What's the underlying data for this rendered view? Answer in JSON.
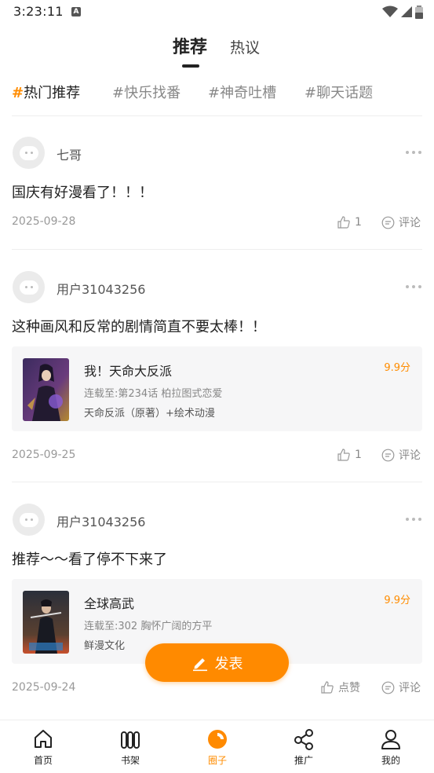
{
  "status_bar": {
    "time": "3:23:11",
    "notif_letter": "A"
  },
  "top_tabs": {
    "active": "推荐",
    "second": "热议"
  },
  "topics": [
    {
      "hash": "#",
      "label": "热门推荐"
    },
    {
      "label": "#快乐找番"
    },
    {
      "label": "#神奇吐槽"
    },
    {
      "label": "#聊天话题"
    }
  ],
  "posts": [
    {
      "user": "七哥",
      "text": "国庆有好漫看了！！！",
      "date": "2025-09-28",
      "likes": "1",
      "comment_label": "评论"
    },
    {
      "user": "用户31043256",
      "text": "这种画风和反常的剧情简直不要太棒！！",
      "card": {
        "title": "我！天命大反派",
        "score": "9.9分",
        "update": "连载至:第234话 柏拉图式恋爱",
        "author": "天命反派（原著）+绘术动漫"
      },
      "date": "2025-09-25",
      "likes": "1",
      "comment_label": "评论"
    },
    {
      "user": "用户31043256",
      "text": "推荐～～看了停不下来了",
      "card": {
        "title": "全球高武",
        "score": "9.9分",
        "update": "连载至:302 胸怀广阔的方平",
        "author": "鲜漫文化"
      },
      "date": "2025-09-24",
      "likes": "点赞",
      "comment_label": "评论"
    }
  ],
  "publish_button": "发表",
  "bottom_nav": [
    {
      "label": "首页",
      "icon": "home-icon"
    },
    {
      "label": "书架",
      "icon": "bookshelf-icon"
    },
    {
      "label": "圈子",
      "icon": "circle-icon",
      "active": true
    },
    {
      "label": "推广",
      "icon": "share-icon"
    },
    {
      "label": "我的",
      "icon": "profile-icon"
    }
  ],
  "colors": {
    "accent": "#ff8a00",
    "text": "#222222",
    "muted": "#888888"
  }
}
